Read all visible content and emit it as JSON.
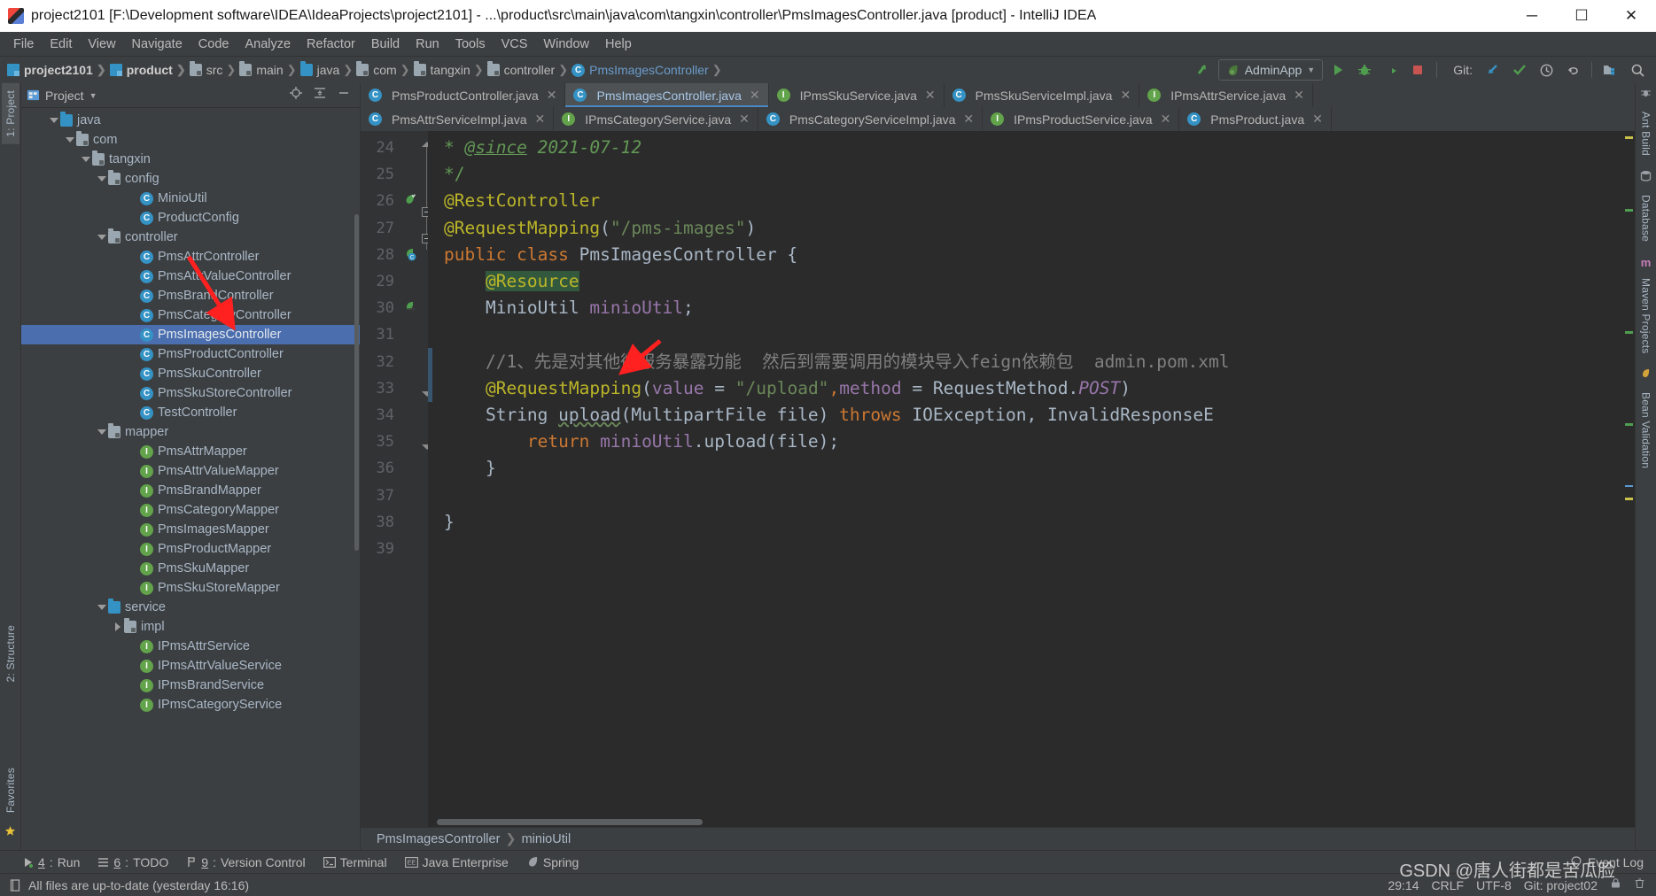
{
  "window": {
    "title": "project2101 [F:\\Development software\\IDEA\\IdeaProjects\\project2101] - ...\\product\\src\\main\\java\\com\\tangxin\\controller\\PmsImagesController.java [product] - IntelliJ IDEA",
    "minimize": "─",
    "maximize": "☐",
    "close": "✕"
  },
  "menu": [
    "File",
    "Edit",
    "View",
    "Navigate",
    "Code",
    "Analyze",
    "Refactor",
    "Build",
    "Run",
    "Tools",
    "VCS",
    "Window",
    "Help"
  ],
  "breadcrumbs": [
    {
      "label": "project2101",
      "icon": "module-icon",
      "bold": true
    },
    {
      "label": "product",
      "icon": "module-icon",
      "bold": true
    },
    {
      "label": "src",
      "icon": "folder-gray-icon",
      "bold": false
    },
    {
      "label": "main",
      "icon": "folder-gray-icon",
      "bold": false
    },
    {
      "label": "java",
      "icon": "folder-blue-icon",
      "bold": false
    },
    {
      "label": "com",
      "icon": "folder-gray-icon",
      "bold": false
    },
    {
      "label": "tangxin",
      "icon": "folder-gray-icon",
      "bold": false
    },
    {
      "label": "controller",
      "icon": "folder-gray-icon",
      "bold": false
    },
    {
      "label": "PmsImagesController",
      "icon": "class-icon",
      "bold": false
    }
  ],
  "toolbar": {
    "run_config": "AdminApp",
    "git_label": "Git:",
    "icons": [
      "build-icon",
      "run-icon",
      "debug-icon",
      "run-coverage-icon",
      "stop-icon",
      "update-project-icon",
      "commit-icon",
      "history-icon",
      "rollback-icon",
      "search-everywhere-icon"
    ]
  },
  "project_panel": {
    "title": "Project",
    "tree": [
      {
        "label": "java",
        "indent": 3,
        "twisty": "down",
        "icon": "folder-blue-icon",
        "type": "folder"
      },
      {
        "label": "com",
        "indent": 4,
        "twisty": "down",
        "icon": "package-icon",
        "type": "package"
      },
      {
        "label": "tangxin",
        "indent": 5,
        "twisty": "down",
        "icon": "package-icon",
        "type": "package"
      },
      {
        "label": "config",
        "indent": 6,
        "twisty": "down",
        "icon": "package-icon",
        "type": "package"
      },
      {
        "label": "MinioUtil",
        "indent": 8,
        "twisty": "none",
        "icon": "class-icon",
        "type": "class"
      },
      {
        "label": "ProductConfig",
        "indent": 8,
        "twisty": "none",
        "icon": "class-icon",
        "type": "class"
      },
      {
        "label": "controller",
        "indent": 6,
        "twisty": "down",
        "icon": "package-icon",
        "type": "package"
      },
      {
        "label": "PmsAttrController",
        "indent": 8,
        "twisty": "none",
        "icon": "class-icon",
        "type": "class"
      },
      {
        "label": "PmsAttrValueController",
        "indent": 8,
        "twisty": "none",
        "icon": "class-icon",
        "type": "class"
      },
      {
        "label": "PmsBrandController",
        "indent": 8,
        "twisty": "none",
        "icon": "class-icon",
        "type": "class"
      },
      {
        "label": "PmsCategoryController",
        "indent": 8,
        "twisty": "none",
        "icon": "class-icon",
        "type": "class"
      },
      {
        "label": "PmsImagesController",
        "indent": 8,
        "twisty": "none",
        "icon": "class-icon",
        "type": "class",
        "selected": true
      },
      {
        "label": "PmsProductController",
        "indent": 8,
        "twisty": "none",
        "icon": "class-icon",
        "type": "class"
      },
      {
        "label": "PmsSkuController",
        "indent": 8,
        "twisty": "none",
        "icon": "class-icon",
        "type": "class"
      },
      {
        "label": "PmsSkuStoreController",
        "indent": 8,
        "twisty": "none",
        "icon": "class-icon",
        "type": "class"
      },
      {
        "label": "TestController",
        "indent": 8,
        "twisty": "none",
        "icon": "class-icon",
        "type": "class"
      },
      {
        "label": "mapper",
        "indent": 6,
        "twisty": "down",
        "icon": "package-icon",
        "type": "package"
      },
      {
        "label": "PmsAttrMapper",
        "indent": 8,
        "twisty": "none",
        "icon": "interface-icon",
        "type": "interface"
      },
      {
        "label": "PmsAttrValueMapper",
        "indent": 8,
        "twisty": "none",
        "icon": "interface-icon",
        "type": "interface"
      },
      {
        "label": "PmsBrandMapper",
        "indent": 8,
        "twisty": "none",
        "icon": "interface-icon",
        "type": "interface"
      },
      {
        "label": "PmsCategoryMapper",
        "indent": 8,
        "twisty": "none",
        "icon": "interface-icon",
        "type": "interface"
      },
      {
        "label": "PmsImagesMapper",
        "indent": 8,
        "twisty": "none",
        "icon": "interface-icon",
        "type": "interface"
      },
      {
        "label": "PmsProductMapper",
        "indent": 8,
        "twisty": "none",
        "icon": "interface-icon",
        "type": "interface"
      },
      {
        "label": "PmsSkuMapper",
        "indent": 8,
        "twisty": "none",
        "icon": "interface-icon",
        "type": "interface"
      },
      {
        "label": "PmsSkuStoreMapper",
        "indent": 8,
        "twisty": "none",
        "icon": "interface-icon",
        "type": "interface"
      },
      {
        "label": "service",
        "indent": 6,
        "twisty": "down",
        "icon": "folder-blue-icon",
        "type": "folder"
      },
      {
        "label": "impl",
        "indent": 7,
        "twisty": "right",
        "icon": "package-icon",
        "type": "package"
      },
      {
        "label": "IPmsAttrService",
        "indent": 8,
        "twisty": "none",
        "icon": "interface-icon",
        "type": "interface"
      },
      {
        "label": "IPmsAttrValueService",
        "indent": 8,
        "twisty": "none",
        "icon": "interface-icon",
        "type": "interface"
      },
      {
        "label": "IPmsBrandService",
        "indent": 8,
        "twisty": "none",
        "icon": "interface-icon",
        "type": "interface"
      },
      {
        "label": "IPmsCategoryService",
        "indent": 8,
        "twisty": "none",
        "icon": "interface-icon",
        "type": "interface"
      }
    ]
  },
  "left_strip": [
    {
      "label": "1: Project",
      "active": true
    },
    {
      "label": "2: Structure",
      "active": false
    },
    {
      "label": "Favorites",
      "active": false
    }
  ],
  "right_strip": [
    {
      "label": "Ant Build"
    },
    {
      "label": "Database"
    },
    {
      "label": "Maven Projects"
    },
    {
      "label": "Bean Validation"
    }
  ],
  "editor_tabs_row1": [
    {
      "label": "PmsProductController.java",
      "icon": "class-icon",
      "active": false
    },
    {
      "label": "PmsImagesController.java",
      "icon": "class-icon",
      "active": true
    },
    {
      "label": "IPmsSkuService.java",
      "icon": "interface-icon",
      "active": false
    },
    {
      "label": "PmsSkuServiceImpl.java",
      "icon": "class-icon",
      "active": false
    },
    {
      "label": "IPmsAttrService.java",
      "icon": "interface-icon",
      "active": false
    }
  ],
  "editor_tabs_row2": [
    {
      "label": "PmsAttrServiceImpl.java",
      "icon": "class-icon",
      "active": false
    },
    {
      "label": "IPmsCategoryService.java",
      "icon": "interface-icon",
      "active": false
    },
    {
      "label": "PmsCategoryServiceImpl.java",
      "icon": "class-icon",
      "active": false
    },
    {
      "label": "IPmsProductService.java",
      "icon": "interface-icon",
      "active": false
    },
    {
      "label": "PmsProduct.java",
      "icon": "class-icon",
      "active": false
    }
  ],
  "code": {
    "first_line_number": 24,
    "lines": [
      {
        "num": 24,
        "text": "* @since 2021-07-12"
      },
      {
        "num": 25,
        "text": "*/"
      },
      {
        "num": 26,
        "text": "@RestController"
      },
      {
        "num": 27,
        "text": "@RequestMapping(\"/pms-images\")"
      },
      {
        "num": 28,
        "text": "public class PmsImagesController {"
      },
      {
        "num": 29,
        "text": "    @Resource"
      },
      {
        "num": 30,
        "text": "    MinioUtil minioUtil;"
      },
      {
        "num": 31,
        "text": ""
      },
      {
        "num": 32,
        "text": "    //1、先是对其他微服务暴露功能  然后到需要调用的模块导入feign依赖包  admin.pom.xml"
      },
      {
        "num": 33,
        "text": "    @RequestMapping(value = \"/upload\",method = RequestMethod.POST)"
      },
      {
        "num": 34,
        "text": "    String upload(MultipartFile file) throws IOException, InvalidResponseE"
      },
      {
        "num": 35,
        "text": "        return minioUtil.upload(file);"
      },
      {
        "num": 36,
        "text": "    }"
      },
      {
        "num": 37,
        "text": ""
      },
      {
        "num": 38,
        "text": "}"
      },
      {
        "num": 39,
        "text": ""
      }
    ]
  },
  "editor_breadcrumb": [
    "PmsImagesController",
    "minioUtil"
  ],
  "tool_windows": [
    {
      "num": "4",
      "label": "Run",
      "icon": "run-icon"
    },
    {
      "num": "6",
      "label": "TODO",
      "icon": "todo-icon"
    },
    {
      "num": "9",
      "label": "Version Control",
      "icon": "vcs-icon"
    },
    {
      "num": "",
      "label": "Terminal",
      "icon": "terminal-icon"
    },
    {
      "num": "",
      "label": "Java Enterprise",
      "icon": "javaee-icon"
    },
    {
      "num": "",
      "label": "Spring",
      "icon": "spring-icon"
    }
  ],
  "event_log": "Event Log",
  "status": {
    "message": "All files are up-to-date (yesterday 16:16)",
    "caret": "29:14",
    "line_separator": "CRLF",
    "encoding": "UTF-8",
    "branch": "Git: project02"
  },
  "watermark": "GSDN @唐人街都是苦瓜脸",
  "colors": {
    "accent_blue": "#4b6eaf",
    "tab_active_underline": "#4a88c7",
    "annotation_yellow": "#bbb529",
    "string_green": "#6a8759",
    "keyword_orange": "#cc7832",
    "field_purple": "#9876aa",
    "comment_gray": "#808080",
    "panel_bg": "#3c3f41",
    "editor_bg": "#2b2b2b",
    "gutter_bg": "#313335",
    "arrow_red": "#ff2020"
  }
}
